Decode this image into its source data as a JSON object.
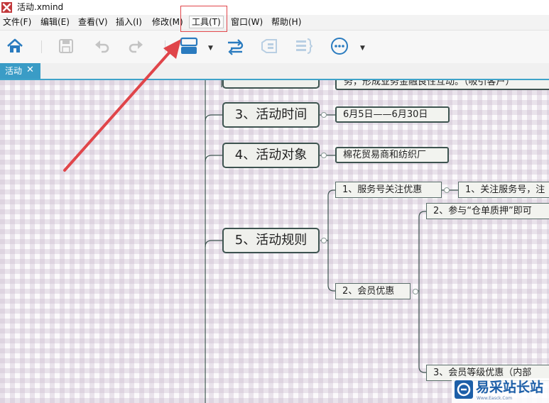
{
  "window": {
    "title": "活动.xmind"
  },
  "menu": [
    {
      "label": "文件(F)"
    },
    {
      "label": "编辑(E)"
    },
    {
      "label": "查看(V)"
    },
    {
      "label": "插入(I)"
    },
    {
      "label": "修改(M)"
    },
    {
      "label": "工具(T)"
    },
    {
      "label": "窗口(W)"
    },
    {
      "label": "帮助(H)"
    }
  ],
  "toolbar": {
    "icons": [
      "home-icon",
      "save-icon",
      "undo-icon",
      "redo-icon",
      "theme-icon",
      "relationship-icon",
      "boundary-icon",
      "summary-icon",
      "more-icon"
    ]
  },
  "tab": {
    "label": "活动",
    "close": "✕"
  },
  "mindmap": {
    "topics": {
      "partial_top": "务，形成业务金融良性互动。（吸引客户）",
      "time": "3、活动时间",
      "time_value": "6月5日——6月30日",
      "target": "4、活动对象",
      "target_value": "棉花贸易商和纺织厂",
      "rules": "5、活动规则",
      "rule_1": "1、服务号关注优惠",
      "rule_1_detail": "1、关注服务号，注",
      "rule_2": "2、会员优惠",
      "rule_2_detail_a": "2、参与“仓单质押”即可",
      "rule_2_detail_b": "3、会员等级优惠（内部"
    }
  },
  "watermark": {
    "text": "易采站长站",
    "url": "Www.Easck.Com"
  },
  "colors": {
    "accent": "#3a9cc6",
    "highlight": "#e0454a",
    "topic_border": "#3e5450"
  }
}
